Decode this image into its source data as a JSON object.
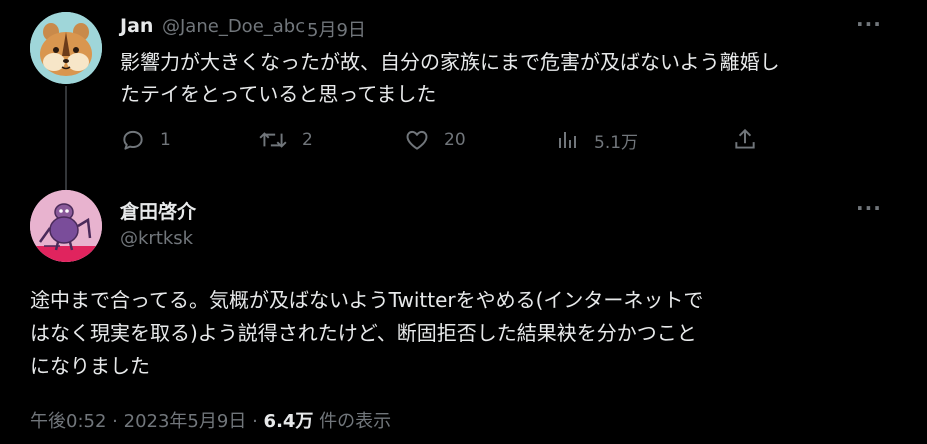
{
  "reply": {
    "display_name": "Jan",
    "handle": "@Jane_Doe_abc",
    "separator": "·",
    "date": "5月9日",
    "text_line1": "影響力が大きくなったが故、自分の家族にまで危害が及ばないよう離婚し",
    "text_line2": "たテイをとっていると思ってました",
    "actions": {
      "reply_count": "1",
      "retweet_count": "2",
      "like_count": "20",
      "views_count": "5.1万"
    }
  },
  "main_tweet": {
    "display_name": "倉田啓介",
    "handle": "@krtksk",
    "text_line1": "途中まで合ってる。気概が及ばないようTwitterをやめる(インターネットで",
    "text_line2": "はなく現実を取る)よう説得されたけど、断固拒否した結果袂を分かつこと",
    "text_line3": "になりました",
    "time": "午後0:52",
    "sep1": "·",
    "date": "2023年5月9日",
    "sep2": "·",
    "views": "6.4万",
    "views_suffix": "件の表示"
  },
  "colors": {
    "background": "#000000",
    "text": "#e7e9ea",
    "muted": "#71767b",
    "thread_line": "#333639"
  },
  "icons": [
    "reply-icon",
    "retweet-icon",
    "like-icon",
    "views-icon",
    "share-icon",
    "more-icon"
  ]
}
